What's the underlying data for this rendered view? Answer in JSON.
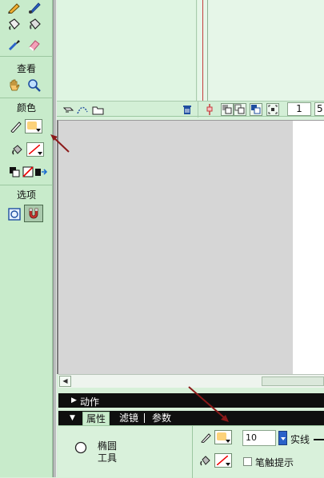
{
  "toolbar": {
    "view_section": "查看",
    "color_section": "颜色",
    "options_section": "选项",
    "fill_color": "#fcd27a",
    "tools_top": [
      "pencil-icon",
      "brush-icon",
      "ink-bottle-icon",
      "paint-bucket-icon",
      "eyedropper-icon",
      "eraser-icon"
    ],
    "view_tools": [
      "hand-icon",
      "zoom-icon"
    ],
    "color_tools": [
      "stroke-pencil-icon",
      "fill-bucket-icon",
      "black-white-icon",
      "no-color-icon",
      "swap-colors-icon"
    ],
    "option_tools": [
      "object-drawing-icon",
      "snap-magnet-icon"
    ]
  },
  "timeline": {
    "current_frame": "1",
    "frame_rate_partial": "5"
  },
  "panels": {
    "actions_label": "动作",
    "tabs": [
      "属性",
      "滤镜",
      "参数"
    ]
  },
  "properties": {
    "tool_name_line1": "椭圆",
    "tool_name_line2": "工具",
    "stroke_size": "10",
    "stroke_style": "实线",
    "stroke_hints_label": "笔触提示",
    "fill_color": "#fcd27a"
  }
}
